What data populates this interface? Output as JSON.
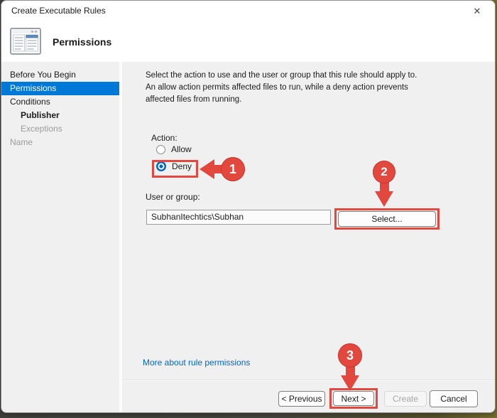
{
  "window": {
    "title": "Create Executable Rules",
    "close_icon": "✕"
  },
  "header": {
    "title": "Permissions",
    "icon": "wizard-window-icon"
  },
  "sidebar": {
    "items": [
      {
        "label": "Before You Begin",
        "state": "normal"
      },
      {
        "label": "Permissions",
        "state": "selected"
      },
      {
        "label": "Conditions",
        "state": "normal"
      },
      {
        "label": "Publisher",
        "state": "sub"
      },
      {
        "label": "Exceptions",
        "state": "sub-disabled"
      },
      {
        "label": "Name",
        "state": "disabled"
      }
    ]
  },
  "content": {
    "description": "Select the action to use and the user or group that this rule should apply to. An allow action permits affected files to run, while a deny action prevents affected files from running.",
    "action": {
      "label": "Action:",
      "options": [
        {
          "label": "Allow",
          "selected": false
        },
        {
          "label": "Deny",
          "selected": true
        }
      ]
    },
    "user_or_group": {
      "label": "User or group:",
      "value": "SubhanItechtics\\Subhan",
      "select_button": "Select..."
    },
    "help_link": "More about rule permissions"
  },
  "footer": {
    "buttons": [
      {
        "label": "< Previous",
        "enabled": true
      },
      {
        "label": "Next >",
        "enabled": true,
        "highlighted": true
      },
      {
        "label": "Create",
        "enabled": false
      },
      {
        "label": "Cancel",
        "enabled": true
      }
    ]
  },
  "annotations": [
    {
      "number": "1",
      "target": "deny-radio"
    },
    {
      "number": "2",
      "target": "select-button"
    },
    {
      "number": "3",
      "target": "next-button"
    }
  ],
  "colors": {
    "accent_blue": "#0078D7",
    "annotation_red": "#E2483E",
    "link_blue": "#0066CC",
    "radio_blue": "#0067C0"
  }
}
